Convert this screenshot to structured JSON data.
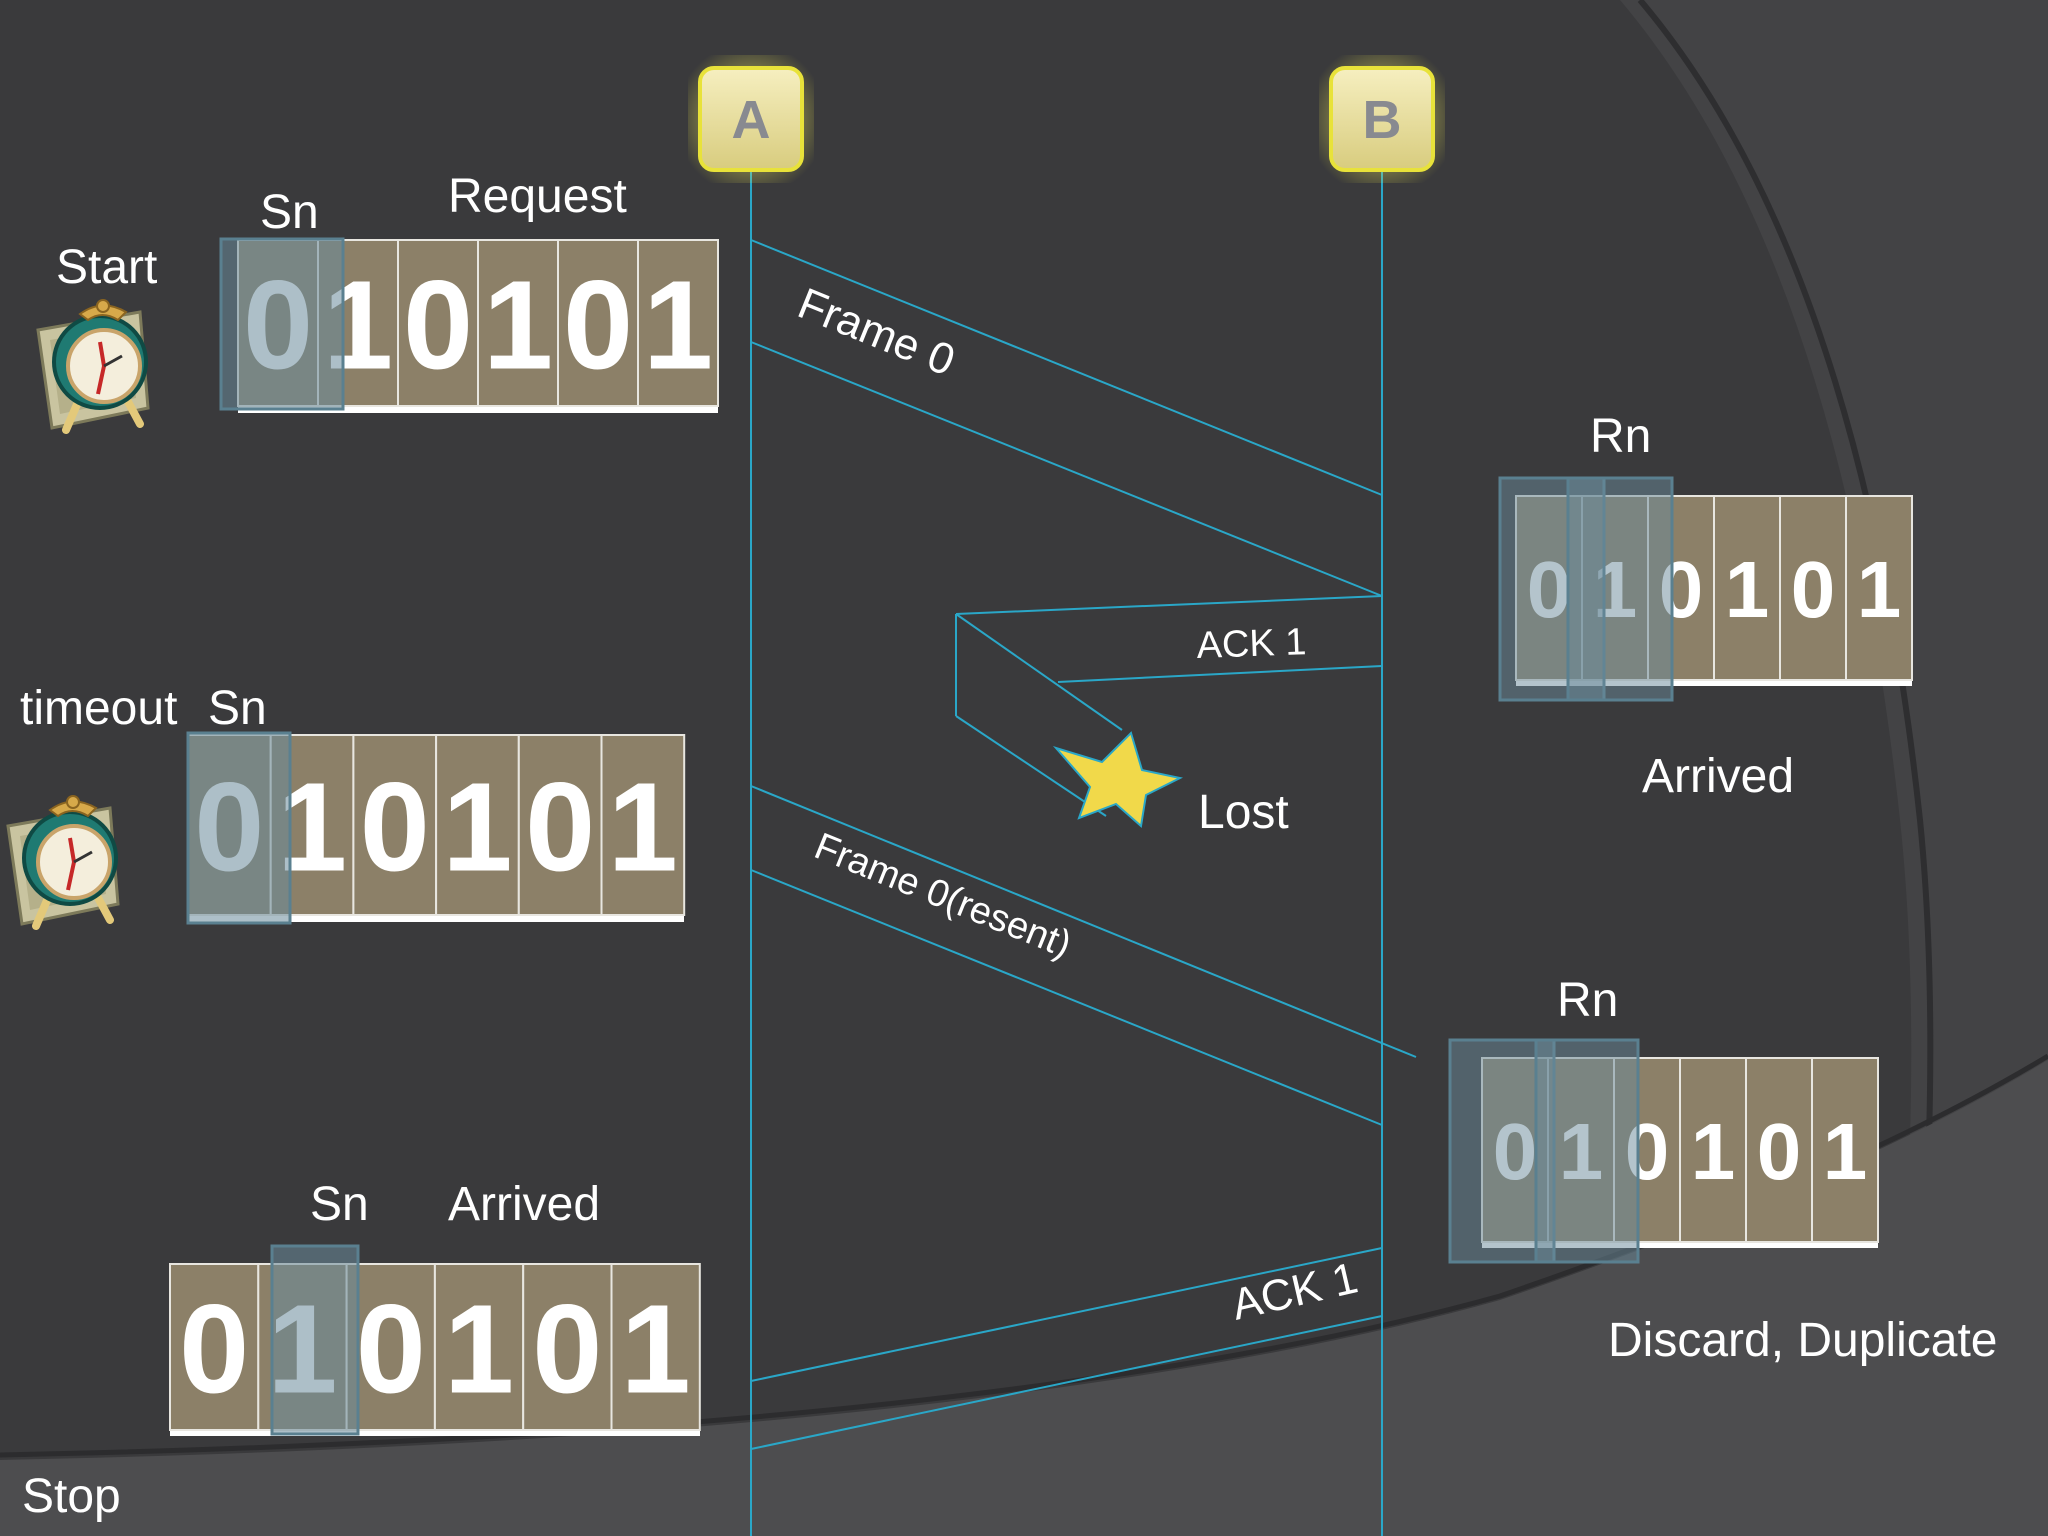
{
  "colors": {
    "background": "#3a3a3c",
    "swoosh_light": "#4e4e50",
    "line": "#2aa7c8",
    "cell": "#8c8068",
    "cell_border": "#e8e6e0",
    "window": "#6a8a9a",
    "node_fill": "#efe6a8",
    "node_glow": "#e8e23a",
    "star": "#f1d94a"
  },
  "nodes": {
    "a": "A",
    "b": "B"
  },
  "sender_start": {
    "start_label": "Start",
    "sn_label": "Sn",
    "request_label": "Request",
    "digits": [
      "0",
      "1",
      "0",
      "1",
      "0",
      "1"
    ]
  },
  "sender_timeout": {
    "timeout_label": "timeout",
    "sn_label": "Sn",
    "digits": [
      "0",
      "1",
      "0",
      "1",
      "0",
      "1"
    ]
  },
  "sender_stop": {
    "sn_label": "Sn",
    "arrived_label": "Arrived",
    "stop_label": "Stop",
    "digits": [
      "0",
      "1",
      "0",
      "1",
      "0",
      "1"
    ]
  },
  "receiver_first": {
    "rn_label": "Rn",
    "arrived_label": "Arrived",
    "digits": [
      "0",
      "1",
      "0",
      "1",
      "0",
      "1"
    ]
  },
  "receiver_second": {
    "rn_label": "Rn",
    "discard_label": "Discard, Duplicate",
    "digits": [
      "0",
      "1",
      "0",
      "1",
      "0",
      "1"
    ]
  },
  "messages": {
    "frame0": "Frame 0",
    "ack1_lost": "ACK 1",
    "lost_label": "Lost",
    "frame0_resent": "Frame 0(resent)",
    "ack1_final": "ACK 1"
  },
  "icons": [
    "alarm-clock-icon",
    "star-icon"
  ]
}
